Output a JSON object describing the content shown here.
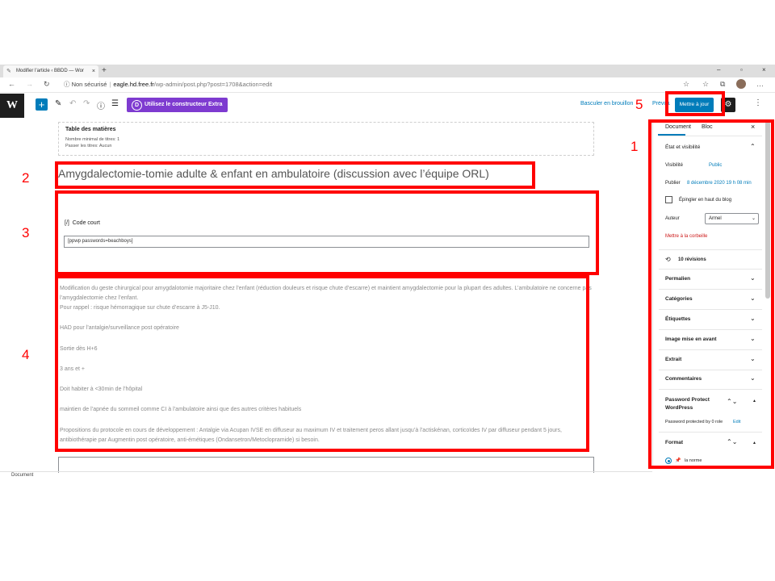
{
  "browser": {
    "tab_title": "Modifier l’article ‹ BBDD — Wor",
    "tab_close": "×",
    "new_tab": "+",
    "win_min": "–",
    "win_max": "▫",
    "win_close": "×",
    "insecure_label": "Non sécurisé",
    "url_host": "eagle.hd.free.fr",
    "url_path": "/wp-admin/post.php?post=1708&action=edit"
  },
  "toolbar": {
    "wp_logo": "W",
    "add_block": "+",
    "extra_icon": "D",
    "extra_builder_label": "Utilisez le constructeur Extra",
    "save_draft": "Basculer en brouillon",
    "preview": "Prévisualiser",
    "update": "Mettre à jour",
    "gear": "⚙",
    "more": "⋮"
  },
  "editor": {
    "toc_title": "Table des matières",
    "toc_line1": "Nombre minimal de titres: 1",
    "toc_line2": "Passer les titres: Aucun",
    "post_title": "Amygdalectomie-tomie adulte & enfant en ambulatoire  (discussion avec l’équipe ORL)",
    "shortcode_icon": "[/]",
    "shortcode_label": "Code court",
    "shortcode_value": "[ppwp passwords=beachboys]",
    "paragraphs": [
      "Modification du geste chirurgical pour amygdalotomie majoritaire chez l’enfant (réduction douleurs et risque chute d’escarre) et maintient amygdalectomie pour la plupart des adultes. L’ambulatoire ne concerne pas l’amygdalectomie chez l’enfant.",
      "Pour rappel : risque hémorragique sur chute d’escarre à J5-J10.",
      "HAD pour l’antalgie/surveillance post opératoire",
      "Sortie dès H+6",
      "3 ans et +",
      "Doit habiter à <30min de l’hôpital",
      "maintien de l’apnée du sommeil comme CI à l’ambulatoire ainsi que des autres critères habituels",
      "Propositions du protocole en cours de développement : Antalgie via Acupan IVSE en diffuseur au maximum IV et traitement peros allant jusqu’à l’actiskénan, corticoïdes IV par diffuseur pendant 5 jours, antibiothérapie par Augmentin post opératoire, anti-émétiques (Ondansetron/Metoclopramide) si besoin."
    ],
    "footer_label": "Document"
  },
  "sidebar": {
    "tab_document": "Document",
    "tab_block": "Bloc",
    "close": "×",
    "status_section": "État et visibilité",
    "visibility_label": "Visibilité",
    "visibility_value": "Public",
    "publish_label": "Publier",
    "publish_value": "8 décembre 2020 19 h 08 min",
    "sticky_label": "Épingler en haut du blog",
    "author_label": "Auteur",
    "author_value": "Armel",
    "trash_label": "Mettre à la corbeille",
    "revisions_label": "10 révisions",
    "permalink": "Permalien",
    "categories": "Catégories",
    "tags": "Étiquettes",
    "featured_image": "Image mise en avant",
    "excerpt": "Extrait",
    "comments": "Commentaires",
    "password_protect": "Password Protect WordPress",
    "password_protected_by": "Password protected by 0 role",
    "edit_link": "Edit",
    "format": "Format",
    "format_value": "la norme"
  },
  "annotations": {
    "n1": "1",
    "n2": "2",
    "n3": "3",
    "n4": "4",
    "n5": "5",
    "color": "#ff0000"
  }
}
